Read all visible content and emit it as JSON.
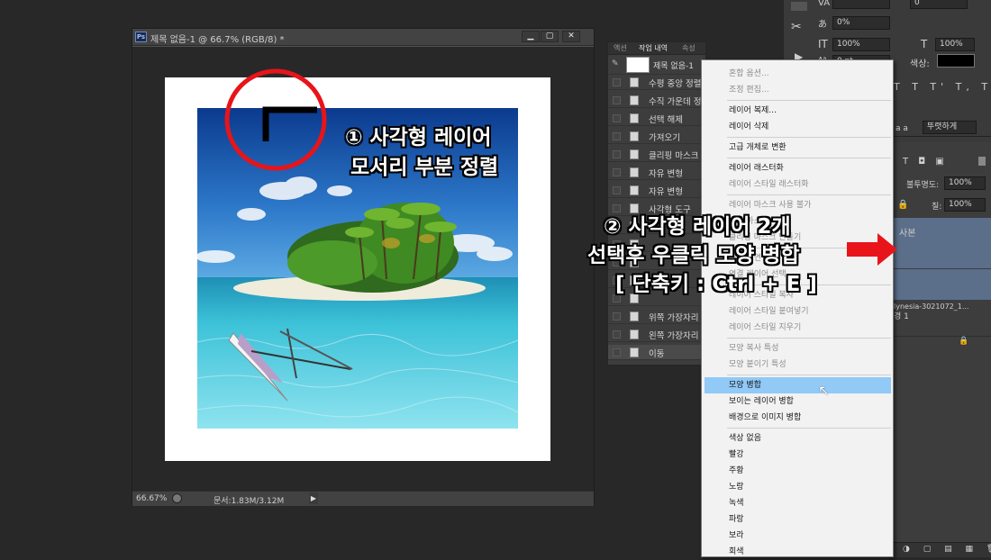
{
  "document": {
    "title": "제목 없음-1 @ 66.7% (RGB/8) *",
    "ps_logo": "Ps",
    "min_label": "▁",
    "max_label": "▢",
    "close_label": "✕",
    "zoom": "66.67%",
    "doc_info": "문서:1.83M/3.12M"
  },
  "history": {
    "tabs": [
      "액션",
      "작업 내역",
      "속성"
    ],
    "snapshot": "제목 없음-1",
    "items": [
      "수평 중앙 정렬",
      "수직 가운데 정",
      "선택 해제",
      "가져오기",
      "클리핑 마스크",
      "자유 변형",
      "자유 변형",
      "사각형 도구",
      "",
      "",
      "",
      "",
      "",
      "위쪽 가장자리",
      "왼쪽 가장자리",
      "이동"
    ]
  },
  "context_menu": {
    "groups": [
      [
        {
          "label": "혼합 옵션...",
          "disabled": true
        },
        {
          "label": "조정 편집...",
          "disabled": true
        }
      ],
      [
        {
          "label": "레이어 복제..."
        },
        {
          "label": "레이어 삭제"
        }
      ],
      [
        {
          "label": "고급 개체로 변환"
        }
      ],
      [
        {
          "label": "레이어 래스터화"
        },
        {
          "label": "레이어 스타일 래스터화",
          "disabled": true
        }
      ],
      [
        {
          "label": "레이어 마스크 사용 불가",
          "disabled": true
        },
        {
          "label": "벡터 마스크 사용",
          "disabled": true
        },
        {
          "label": "클리핑 마스크 만들기",
          "disabled": true
        }
      ],
      [
        {
          "label": "레이어 연결",
          "disabled": true
        },
        {
          "label": "연결 레이어 선택",
          "disabled": true
        }
      ],
      [
        {
          "label": "레이어 스타일 복사",
          "disabled": true
        },
        {
          "label": "레이어 스타일 붙여넣기",
          "disabled": true
        },
        {
          "label": "레이어 스타일 지우기",
          "disabled": true
        }
      ],
      [
        {
          "label": "모양 복사 특성",
          "disabled": true
        },
        {
          "label": "모양 붙이기 특성",
          "disabled": true
        }
      ],
      [
        {
          "label": "모양 병합",
          "highlighted": true
        },
        {
          "label": "보이는 레이어 병합"
        },
        {
          "label": "배경으로 이미지 병합"
        }
      ],
      [
        {
          "label": "색상 없음"
        },
        {
          "label": "빨강"
        },
        {
          "label": "주황"
        },
        {
          "label": "노랑"
        },
        {
          "label": "녹색"
        },
        {
          "label": "파랑"
        },
        {
          "label": "보라"
        },
        {
          "label": "회색"
        }
      ]
    ]
  },
  "right_panel": {
    "tracking": "0%",
    "vscale": "100%",
    "hscale": "100%",
    "baseline": "0 pt",
    "kerning_value": "0",
    "color_label": "색상:",
    "aa_label": "a a",
    "aa_value": "뚜렷하게",
    "opacity_label": "불투명도:",
    "opacity_value": "100%",
    "fill_label": "칠:",
    "fill_value": "100%",
    "layer_copy": "사본",
    "layer_polynesia": "lynesia-3021072_1...",
    "layer_bg_label": "경 1",
    "lock_icon": "🔒",
    "type_styles": "T T T' T, T T"
  },
  "annotations": {
    "step1_line1": "① 사각형 레이어",
    "step1_line2": "모서리 부분 정렬",
    "step2_line1": "② 사각형 레이어 2개",
    "step2_line2": "선택후 우클릭 모양 병합",
    "step2_line3": "[ 단축키 : Ctrl + E ]"
  },
  "colors": {
    "accent_red": "#e8141a",
    "highlight_blue": "#91c9f7"
  }
}
